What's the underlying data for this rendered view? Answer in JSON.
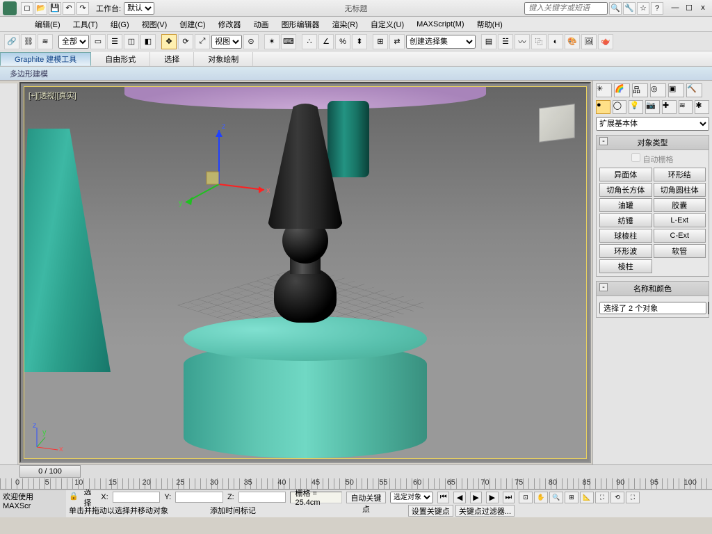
{
  "title": "无标题",
  "workspace": {
    "label": "工作台:",
    "value": "默认"
  },
  "search": {
    "placeholder": "键入关键字或短语"
  },
  "wincontrols": {
    "min": "—",
    "max": "☐",
    "close": "x"
  },
  "menubar": [
    "编辑(E)",
    "工具(T)",
    "组(G)",
    "视图(V)",
    "创建(C)",
    "修改器",
    "动画",
    "图形编辑器",
    "渲染(R)",
    "自定义(U)",
    "MAXScript(M)",
    "帮助(H)"
  ],
  "toolbar": {
    "all_filter": "全部",
    "view_btn": "视图",
    "named_sel": "创建选择集"
  },
  "ribbon": {
    "tabs": [
      "Graphite 建模工具",
      "自由形式",
      "选择",
      "对象绘制"
    ],
    "active": 0,
    "sub": "多边形建模"
  },
  "viewport": {
    "label": "[+][透视][真实]"
  },
  "panel": {
    "dropdown": "扩展基本体",
    "section_obj": "对象类型",
    "autogrid": "自动栅格",
    "buttons": [
      "异面体",
      "环形结",
      "切角长方体",
      "切角圆柱体",
      "油罐",
      "胶囊",
      "纺锤",
      "L-Ext",
      "球棱柱",
      "C-Ext",
      "环形波",
      "软管",
      "棱柱",
      ""
    ],
    "section_name": "名称和颜色",
    "sel_text": "选择了 2 个对象"
  },
  "timeline": {
    "slider_text": "0 / 100",
    "ticks": [
      "0",
      "5",
      "10",
      "15",
      "20",
      "25",
      "30",
      "35",
      "40",
      "45",
      "50",
      "55",
      "60",
      "65",
      "70",
      "75",
      "80",
      "85",
      "90",
      "95",
      "100"
    ]
  },
  "status": {
    "welcome": "欢迎使用 MAXScr",
    "sel_label": "选择",
    "x_label": "X:",
    "y_label": "Y:",
    "z_label": "Z:",
    "grid": "栅格 = 25.4cm",
    "hint1": "单击并拖动以选择并移动对象",
    "hint2": "添加时间标记",
    "autokey": "自动关键点",
    "setkey": "设置关键点",
    "keyfilter": "关键点过滤器...",
    "sel_obj": "选定对象"
  }
}
